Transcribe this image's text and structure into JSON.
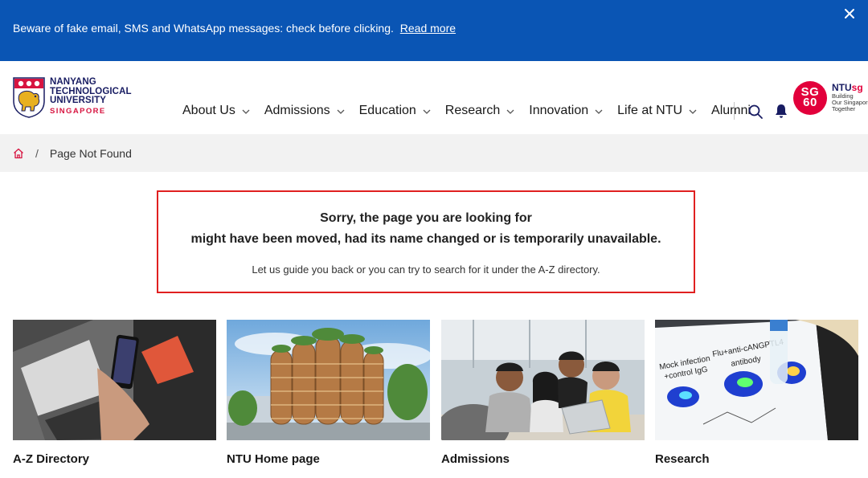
{
  "alert": {
    "message": "Beware of fake email, SMS and WhatsApp messages: check before clicking.",
    "link_label": "Read more",
    "close_icon": "close-icon"
  },
  "logo": {
    "line1": "NANYANG",
    "line2": "TECHNOLOGICAL",
    "line3": "UNIVERSITY",
    "line4": "SINGAPORE"
  },
  "nav": {
    "items": [
      {
        "label": "About Us",
        "has_menu": true
      },
      {
        "label": "Admissions",
        "has_menu": true
      },
      {
        "label": "Education",
        "has_menu": true
      },
      {
        "label": "Research",
        "has_menu": true
      },
      {
        "label": "Innovation",
        "has_menu": true
      },
      {
        "label": "Life at NTU",
        "has_menu": true
      },
      {
        "label": "Alumni",
        "has_menu": false
      }
    ],
    "search_icon": "search-icon",
    "bell_icon": "bell-icon"
  },
  "sg60": {
    "badge_top": "SG",
    "badge_bottom": "60",
    "brand_ntu": "NTU",
    "brand_sg": "sg",
    "tagline1": "Building",
    "tagline2": "Our Singapore",
    "tagline3": "Together"
  },
  "breadcrumb": {
    "separator": "/",
    "current": "Page Not Found"
  },
  "error": {
    "title_line1": "Sorry, the page you are looking for",
    "title_line2": "might have been moved, had its name changed or is temporarily unavailable.",
    "subtitle": "Let us guide you back or you can try to search for it under the A-Z directory."
  },
  "cards": [
    {
      "title": "A-Z Directory"
    },
    {
      "title": "NTU Home page"
    },
    {
      "title": "Admissions"
    },
    {
      "title": "Research"
    }
  ],
  "colors": {
    "alert_bg": "#0a55b4",
    "brand_navy": "#181c62",
    "brand_red": "#d71440",
    "error_border": "#e02020",
    "breadcrumb_bg": "#f2f2f2"
  }
}
